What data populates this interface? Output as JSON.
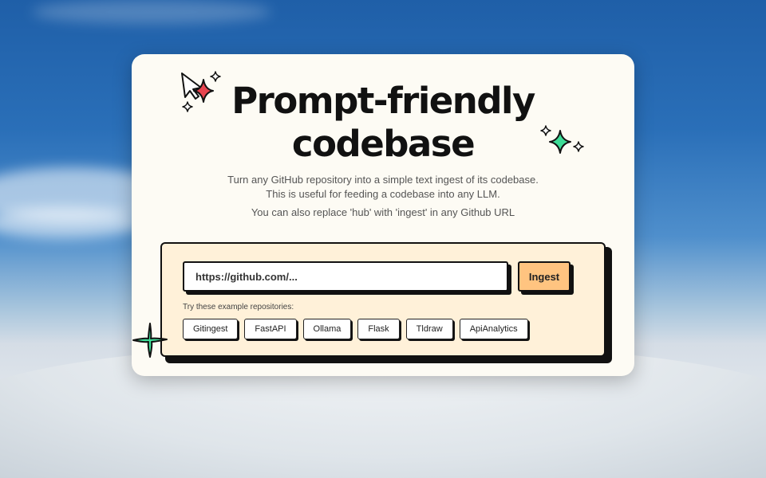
{
  "hero": {
    "title_line1": "Prompt-friendly",
    "title_line2": "codebase",
    "desc_line1": "Turn any GitHub repository into a simple text ingest of its codebase.",
    "desc_line2": "This is useful for feeding a codebase into any LLM.",
    "desc_line3": "You can also replace 'hub' with 'ingest' in any Github URL"
  },
  "form": {
    "url_placeholder": "https://github.com/...",
    "url_value": "",
    "submit_label": "Ingest",
    "examples_label": "Try these example repositories:",
    "examples": [
      "Gitingest",
      "FastAPI",
      "Ollama",
      "Flask",
      "Tldraw",
      "ApiAnalytics"
    ]
  },
  "colors": {
    "card_bg": "#fdfbf4",
    "panel_bg": "#fff1d9",
    "button_bg": "#ffc480",
    "sparkle_red": "#e8444f",
    "sparkle_green": "#3ddc97"
  },
  "icons": [
    "cursor-sparkle-icon",
    "sparkle-icon",
    "star-icon"
  ]
}
